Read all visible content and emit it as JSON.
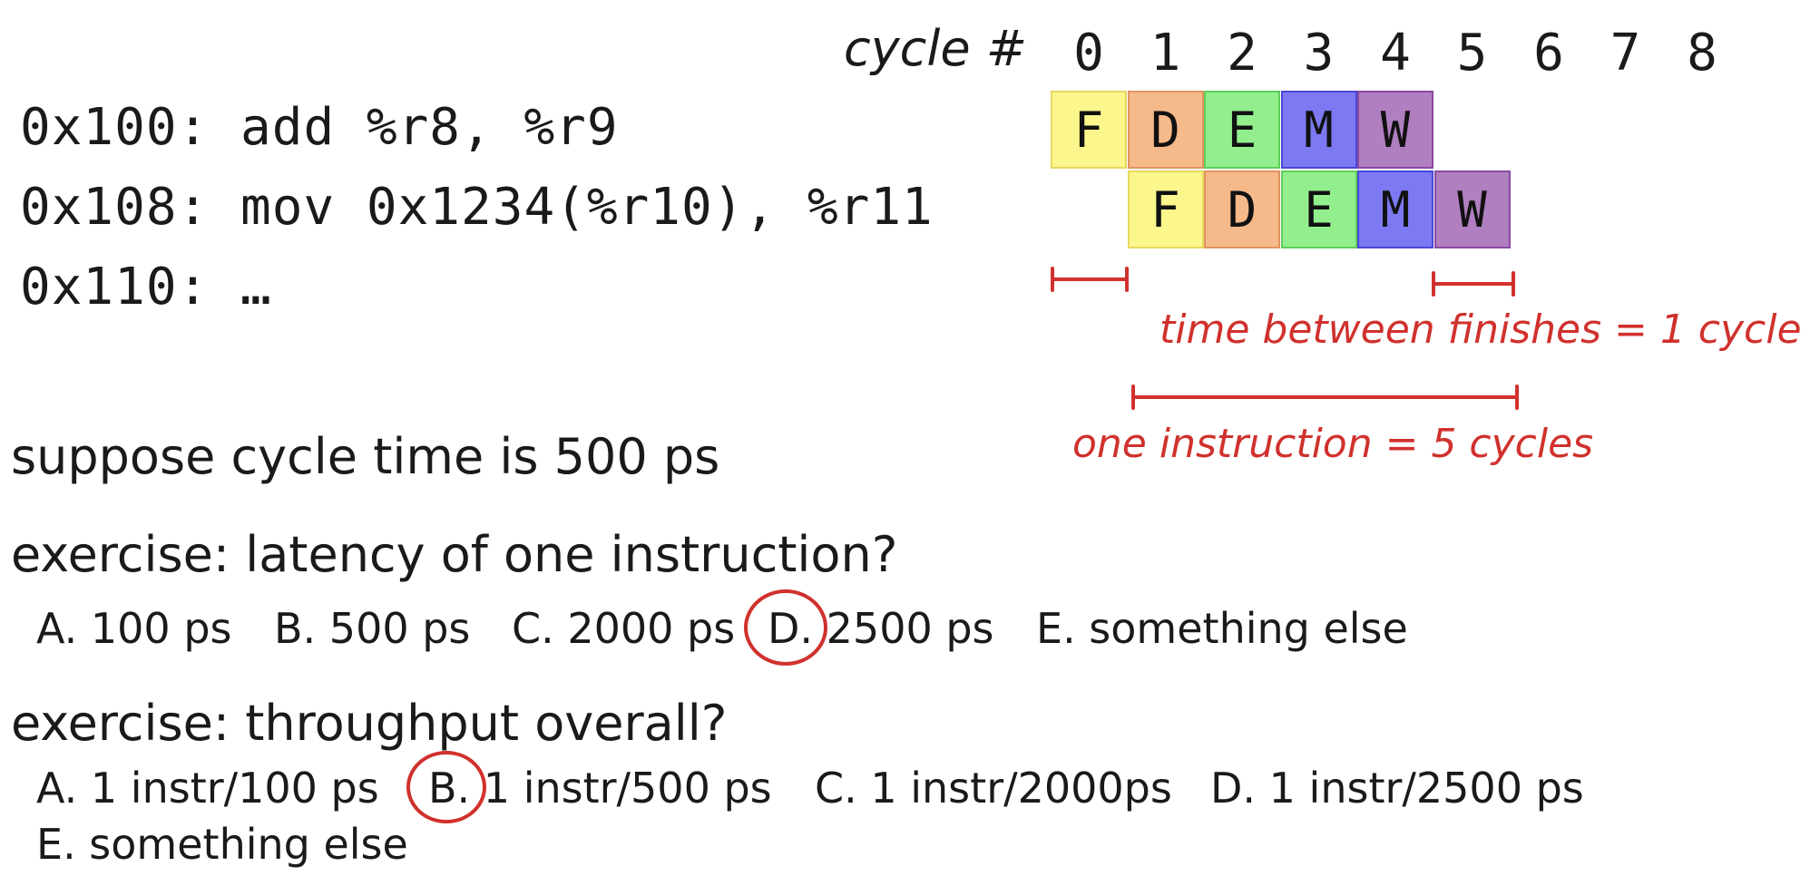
{
  "code": {
    "lines": [
      {
        "addr": "0x100:",
        "instr": "add %r8, %r9"
      },
      {
        "addr": "0x108:",
        "instr": "mov 0x1234(%r10), %r11"
      },
      {
        "addr": "0x110:",
        "instr": "…"
      }
    ]
  },
  "pipeline": {
    "cycle_label": "cycle #",
    "cycles": [
      "0",
      "1",
      "2",
      "3",
      "4",
      "5",
      "6",
      "7",
      "8"
    ],
    "rows": [
      {
        "start": 0,
        "stages": [
          "F",
          "D",
          "E",
          "M",
          "W"
        ]
      },
      {
        "start": 1,
        "stages": [
          "F",
          "D",
          "E",
          "M",
          "W"
        ]
      }
    ],
    "stage_colors": {
      "F": {
        "fill": "#fbf78c",
        "border": "#e8d860"
      },
      "D": {
        "fill": "#f5b98a",
        "border": "#e0945e"
      },
      "E": {
        "fill": "#93ef8e",
        "border": "#5fce5a"
      },
      "M": {
        "fill": "#7c79f2",
        "border": "#4a46d8"
      },
      "W": {
        "fill": "#b07fc0",
        "border": "#8a4aa0"
      }
    }
  },
  "annotations": {
    "color": "#d0312d",
    "between": "time between finishes = 1 cycle",
    "latency": "one instruction = 5 cycles"
  },
  "prompt": "suppose cycle time is 500 ps",
  "ex1": {
    "question": "exercise: latency of one instruction?",
    "options": [
      "A. 100 ps",
      "B. 500 ps",
      "C. 2000 ps",
      "D. 2500 ps",
      "E. something else"
    ],
    "circled": "D."
  },
  "ex2": {
    "question": "exercise: throughput overall?",
    "options": [
      "A. 1 instr/100 ps",
      "B. 1 instr/500 ps",
      "C. 1 instr/2000ps",
      "D. 1 instr/2500 ps",
      "E. something else"
    ],
    "circled": "B."
  }
}
